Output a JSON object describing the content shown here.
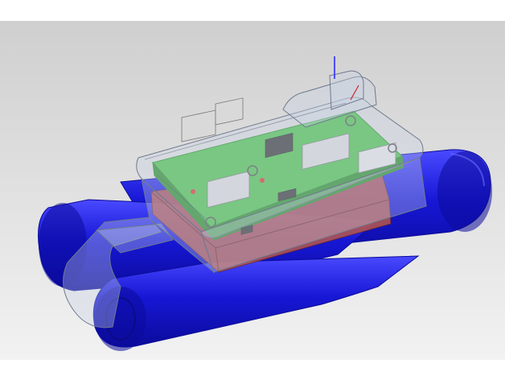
{
  "viewport": {
    "background_top": "#ffffff",
    "gradient_top": "#cfcfcf",
    "gradient_bottom": "#f2f2f2"
  },
  "model": {
    "battery_color": "#1717d6",
    "battery_shade": "#0b0b9a",
    "battery_highlight": "#4a4aff",
    "pcb_color": "#4fc14f",
    "pcb_edge": "#2f8f2f",
    "battery_pack_color": "#b8564a",
    "enclosure_color": "#c9d3e6",
    "enclosure_edge": "#6f7a8c",
    "chip_color": "#3b3b3b",
    "module_color": "#d9d9d9",
    "connector_color": "#e3e3e3"
  },
  "icons": {
    "axis_triad": "axis-triad-icon"
  }
}
